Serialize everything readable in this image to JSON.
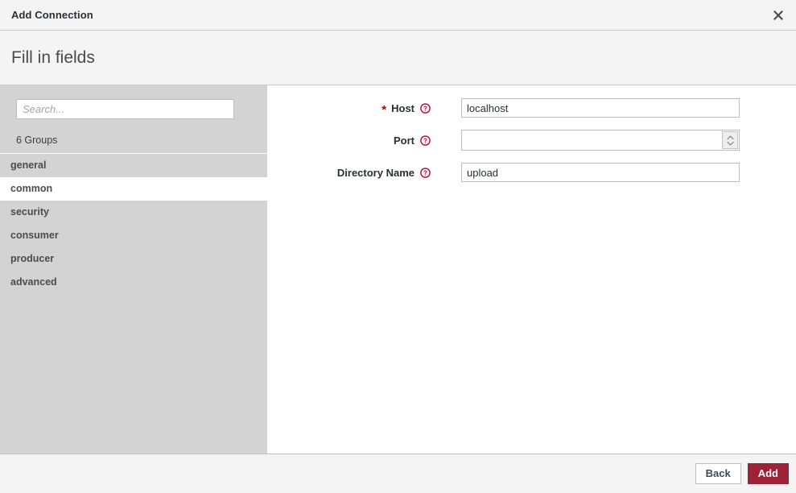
{
  "window": {
    "title": "Add Connection",
    "close_icon": "close-icon"
  },
  "header": {
    "title": "Fill in fields"
  },
  "sidebar": {
    "search": {
      "placeholder": "Search...",
      "value": ""
    },
    "groups_count_label": "6 Groups",
    "items": [
      {
        "label": "general",
        "active": false
      },
      {
        "label": "common",
        "active": true
      },
      {
        "label": "security",
        "active": false
      },
      {
        "label": "consumer",
        "active": false
      },
      {
        "label": "producer",
        "active": false
      },
      {
        "label": "advanced",
        "active": false
      }
    ]
  },
  "form": {
    "fields": [
      {
        "label": "Host",
        "required": true,
        "required_marker": "*",
        "help_icon": "help-circle-icon",
        "type": "text",
        "value": "localhost",
        "placeholder": ""
      },
      {
        "label": "Port",
        "required": false,
        "required_marker": "",
        "help_icon": "help-circle-icon",
        "type": "number",
        "value": "",
        "placeholder": ""
      },
      {
        "label": "Directory Name",
        "required": false,
        "required_marker": "",
        "help_icon": "help-circle-icon",
        "type": "text",
        "value": "upload",
        "placeholder": ""
      }
    ]
  },
  "footer": {
    "back_label": "Back",
    "add_label": "Add"
  },
  "colors": {
    "accent_primary": "#9c2336",
    "required_star": "#c10000",
    "help_icon": "#cc0033",
    "sidebar_bg": "#d3d3d3",
    "chrome_bg": "#f4f4f4"
  }
}
